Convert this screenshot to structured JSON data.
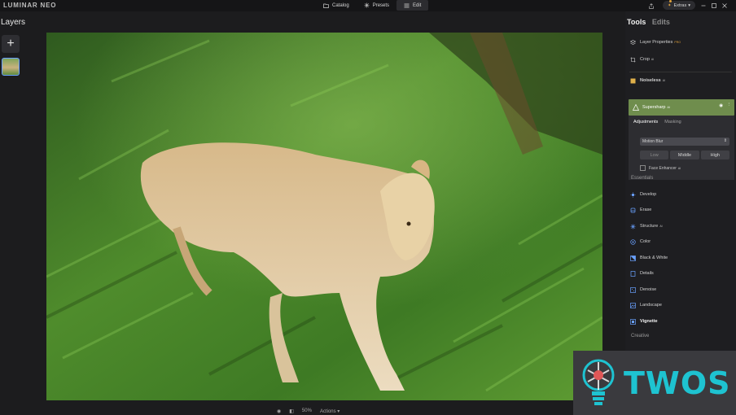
{
  "app": {
    "name": "LUMINAR NEO"
  },
  "nav": {
    "tabs": [
      {
        "label": "Catalog"
      },
      {
        "label": "Presets"
      },
      {
        "label": "Edit"
      }
    ]
  },
  "header": {
    "extras_label": "Extras"
  },
  "layers": {
    "title": "Layers",
    "add_symbol": "+"
  },
  "bottom": {
    "zoom": "50%",
    "actions_label": "Actions"
  },
  "panel": {
    "tab_tools": "Tools",
    "tab_edits": "Edits",
    "top_items": [
      {
        "label": "Layer Properties",
        "badge": "PRO",
        "icon": "layers-icon"
      },
      {
        "label": "Crop",
        "badge": "AI",
        "icon": "crop-icon"
      }
    ],
    "noiseless": {
      "label": "Noiseless",
      "badge": "AI",
      "icon": "noiseless-icon"
    },
    "supersharp": {
      "label": "Supersharp",
      "badge": "AI",
      "icon": "supersharp-icon",
      "sub_tabs": [
        "Adjustments",
        "Masking"
      ],
      "select_value": "Motion Blur",
      "levels": [
        "Low",
        "Middle",
        "High"
      ],
      "face_enhancer": "Face Enhancer",
      "face_badge": "AI"
    },
    "essentials_title": "Essentials",
    "essentials": [
      {
        "label": "Develop",
        "icon": "develop-icon"
      },
      {
        "label": "Erase",
        "icon": "erase-icon"
      },
      {
        "label": "Structure",
        "badge": "AI",
        "icon": "structure-icon"
      },
      {
        "label": "Color",
        "icon": "color-icon"
      },
      {
        "label": "Black & White",
        "icon": "black-white-icon"
      },
      {
        "label": "Details",
        "icon": "details-icon"
      },
      {
        "label": "Denoise",
        "icon": "denoise-icon"
      },
      {
        "label": "Landscape",
        "icon": "landscape-icon"
      },
      {
        "label": "Vignette",
        "icon": "vignette-icon"
      }
    ],
    "creative_title": "Creative"
  },
  "watermark": {
    "text": "TWOS"
  },
  "colors": {
    "accent": "#6aa1ff",
    "supersharp_bg": "#6f8d4d",
    "watermark": "#1ec3d1",
    "extras_dot": "#e0a23a"
  }
}
